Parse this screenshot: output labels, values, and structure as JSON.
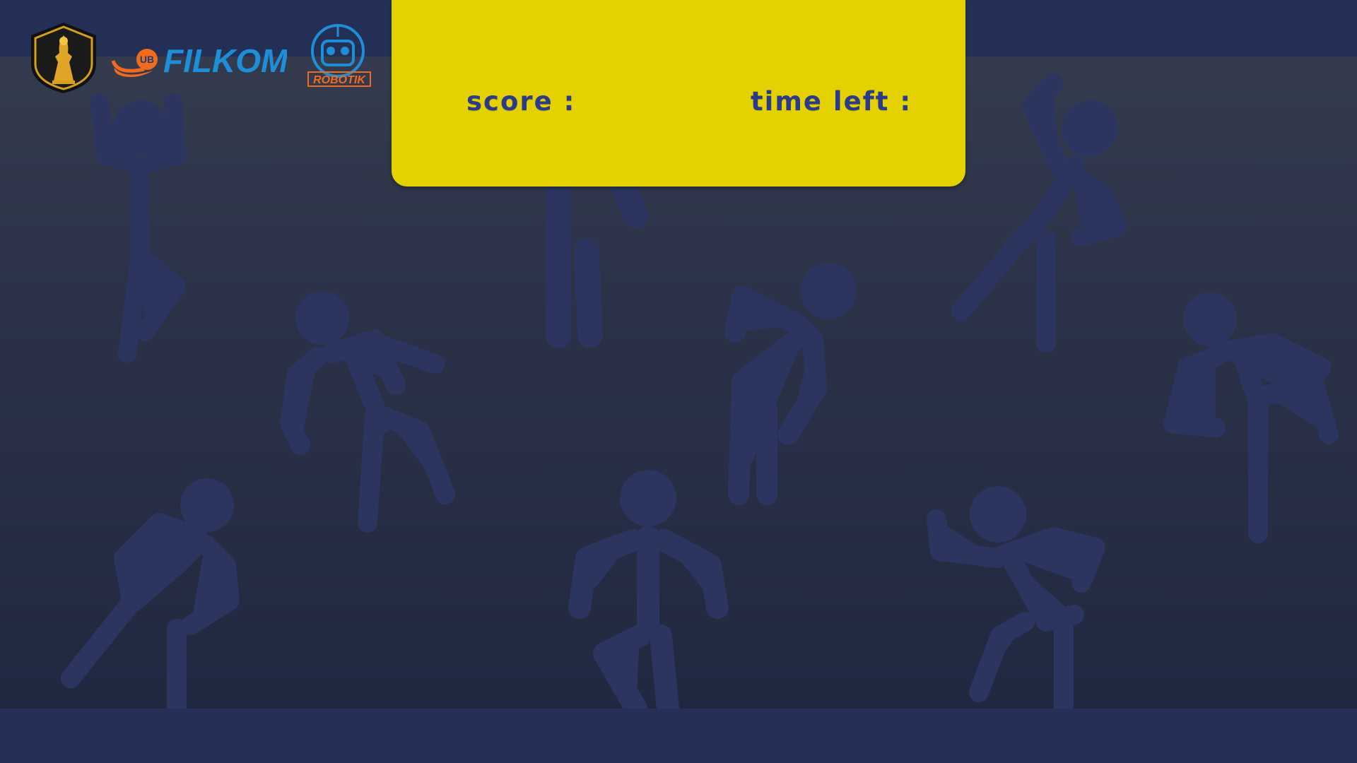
{
  "hud": {
    "score_label": "score :",
    "time_label": "time left :"
  },
  "logos": {
    "university": "ub-crest-icon",
    "faculty_badge": "UB",
    "faculty_name": "FILKOM",
    "club_name": "ROBOTIK"
  },
  "colors": {
    "panel": "#e3d100",
    "label": "#2c3a8c",
    "bar": "#242f55",
    "figure": "#2b3560",
    "filkom_orange": "#f26a1b",
    "filkom_blue": "#1e8fd6"
  }
}
